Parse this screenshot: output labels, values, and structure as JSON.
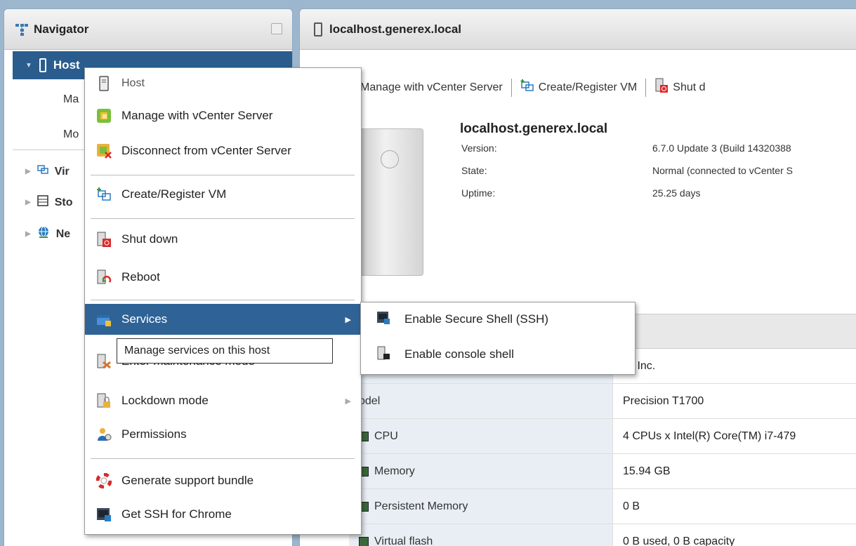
{
  "navigator": {
    "title": "Navigator",
    "host_label": "Host",
    "sub_items": [
      "Ma",
      "Mo"
    ],
    "tree": [
      "Vir",
      "Sto",
      "Ne"
    ]
  },
  "main": {
    "title": "localhost.generex.local",
    "toolbar": {
      "manage": "Manage with vCenter Server",
      "create": "Create/Register VM",
      "shutdown": "Shut d"
    },
    "host_name": "localhost.generex.local",
    "info": [
      {
        "label": "Version:",
        "value": "6.7.0 Update 3 (Build 14320388"
      },
      {
        "label": "State:",
        "value": "Normal (connected to vCenter S"
      },
      {
        "label": "Uptime:",
        "value": "25.25 days"
      }
    ],
    "hardware": [
      {
        "label": "",
        "value": "ell Inc."
      },
      {
        "label": "odel",
        "value": "Precision T1700"
      },
      {
        "label": "CPU",
        "value": "4 CPUs x Intel(R) Core(TM) i7-479"
      },
      {
        "label": "Memory",
        "value": "15.94 GB"
      },
      {
        "label": "Persistent Memory",
        "value": "0 B"
      },
      {
        "label": "Virtual flash",
        "value": "0 B used, 0 B capacity"
      }
    ]
  },
  "context_menu": {
    "title": "Host",
    "items": {
      "manage": "Manage with vCenter Server",
      "disconnect": "Disconnect from vCenter Server",
      "create": "Create/Register VM",
      "shutdown": "Shut down",
      "reboot": "Reboot",
      "services": "Services",
      "maintenance": "Enter maintenance mode",
      "lockdown": "Lockdown mode",
      "permissions": "Permissions",
      "support": "Generate support bundle",
      "ssh_chrome": "Get SSH for Chrome"
    }
  },
  "submenu": {
    "ssh": "Enable Secure Shell (SSH)",
    "console": "Enable console shell"
  },
  "tooltip": "Manage services on this host",
  "colors": {
    "selected": "#2f6396",
    "host_row": "#2a5d8e"
  }
}
